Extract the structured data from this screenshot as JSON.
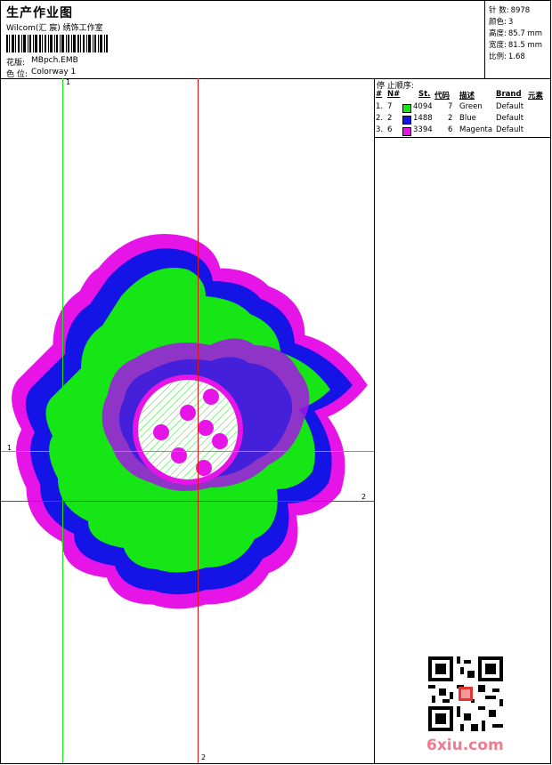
{
  "header": {
    "title": "生产作业图",
    "company": "Wilcom(汇 宸) 绣饰工作室",
    "pattern_label": "花版:",
    "pattern_value": "MBpch.EMB",
    "color_label": "色 位:",
    "color_value": "Colorway 1"
  },
  "stats": [
    {
      "label": "针 数:",
      "value": "8978"
    },
    {
      "label": "颜色:",
      "value": "3"
    },
    {
      "label": "高度:",
      "value": "85.7 mm"
    },
    {
      "label": "宽度:",
      "value": "81.5 mm"
    },
    {
      "label": "比例:",
      "value": "1.68"
    }
  ],
  "canvas": {
    "marker_1_top": "1",
    "marker_1_left": "1",
    "marker_2_right": "2",
    "marker_2_bottom": "2"
  },
  "colors": {
    "green": "#16e616",
    "blue": "#1414e6",
    "magenta": "#e614e6",
    "red_line": "#e31414"
  },
  "stop_sequence": {
    "title": "停 止顺序:",
    "headers": [
      "#",
      "N#",
      "St.",
      "代码",
      "描述",
      "Brand",
      "元素"
    ],
    "rows": [
      {
        "idx": "1.",
        "n": "7",
        "st": "4094",
        "code": "7",
        "desc": "Green",
        "brand": "Default",
        "color": "#16e616"
      },
      {
        "idx": "2.",
        "n": "2",
        "st": "1488",
        "code": "2",
        "desc": "Blue",
        "brand": "Default",
        "color": "#1414e6"
      },
      {
        "idx": "3.",
        "n": "6",
        "st": "3394",
        "code": "6",
        "desc": "Magenta",
        "brand": "Default",
        "color": "#e614e6"
      }
    ]
  },
  "watermark": "6xiu.com"
}
